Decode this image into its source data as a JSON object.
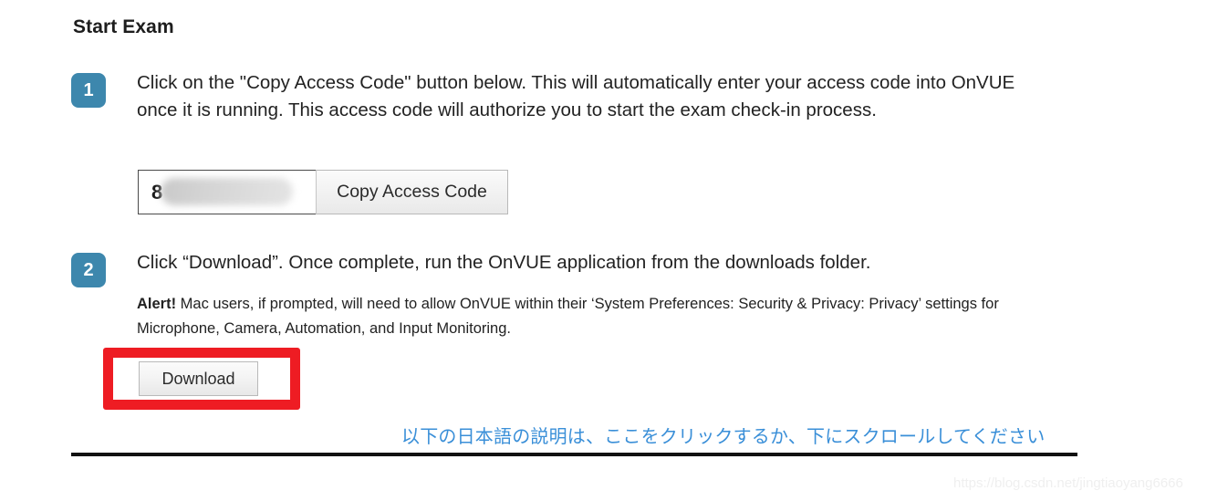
{
  "page": {
    "title": "Start Exam",
    "accent_badge_color": "#3d87ad",
    "annotation_color": "#ee1c23",
    "link_color": "#3a8fd8"
  },
  "steps": [
    {
      "number": "1",
      "text": "Click on the \"Copy Access Code\" button below. This will automatically enter your access code into OnVUE once it is running. This access code will authorize you to start the exam check-in process."
    },
    {
      "number": "2",
      "text": "Click “Download”. Once complete, run the OnVUE application from the downloads folder."
    }
  ],
  "access_code": {
    "value": "8",
    "placeholder": "",
    "redacted": true,
    "copy_button_label": "Copy Access Code"
  },
  "alert": {
    "lead": "Alert!",
    "body": " Mac users, if prompted, will need to allow OnVUE within their ‘System Preferences: Security & Privacy: Privacy’ settings for Microphone, Camera, Automation, and Input Monitoring."
  },
  "download": {
    "button_label": "Download"
  },
  "japanese_link": {
    "text": "以下の日本語の説明は、ここをクリックするか、下にスクロールしてください"
  },
  "watermark": {
    "text": "https://blog.csdn.net/jingtiaoyang6666"
  }
}
